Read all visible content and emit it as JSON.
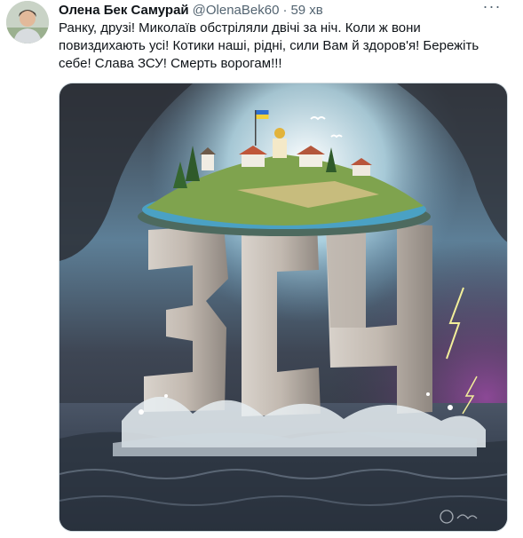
{
  "tweet": {
    "author_name": "Олена Бек Самурай",
    "handle": "@OlenaBek60",
    "separator": "·",
    "time": "59 хв",
    "text": "Ранку, друзі! Миколаїв обстріляли двічі за ніч. Коли ж вони повиздихають усі! Котики наші, рідні, сили Вам й здоров'я! Бережіть себе! Слава ЗСУ! Смерть ворогам!!!",
    "more_icon": "more-horizontal-icon",
    "image": {
      "letters": [
        "З",
        "С",
        "У"
      ],
      "signature": "Olena"
    }
  }
}
